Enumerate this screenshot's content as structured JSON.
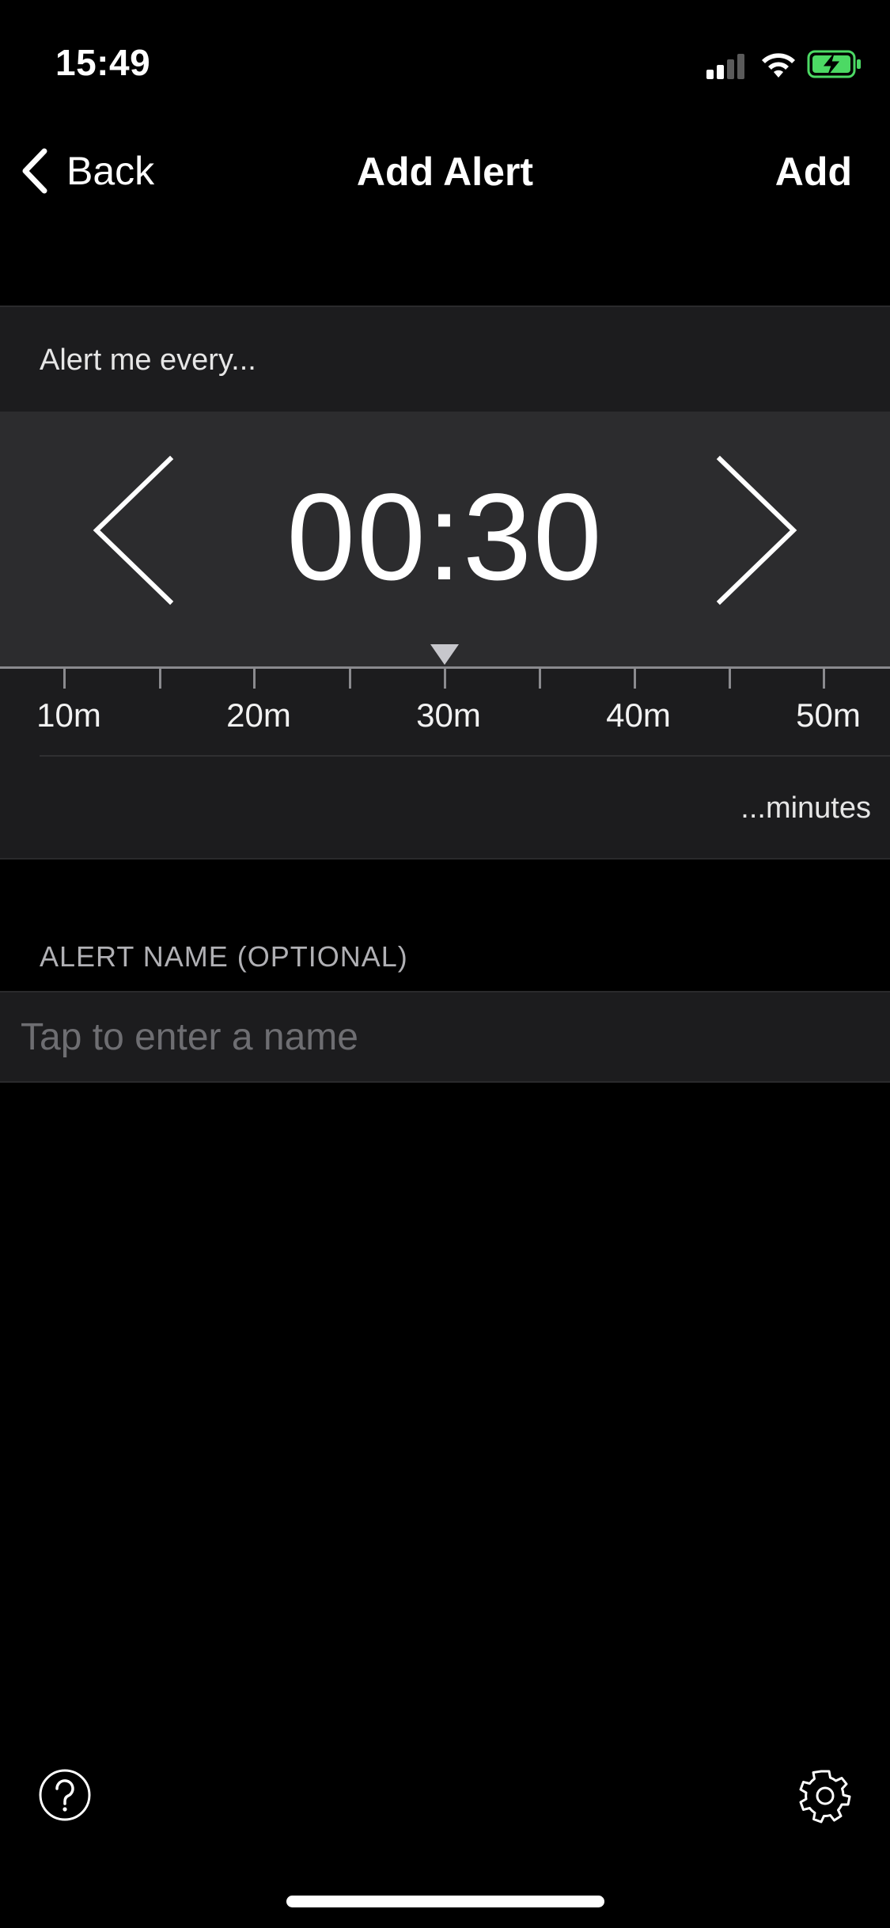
{
  "status_bar": {
    "time": "15:49",
    "battery_color": "#4cd964"
  },
  "nav": {
    "back_label": "Back",
    "title": "Add Alert",
    "add_label": "Add"
  },
  "interval": {
    "heading": "Alert me every...",
    "time_value": "00:30",
    "ruler_labels": [
      "10m",
      "20m",
      "30m",
      "40m",
      "50m"
    ],
    "selected_minutes": 30,
    "unit_label": "...minutes"
  },
  "alert_name": {
    "section_header": "ALERT NAME (OPTIONAL)",
    "placeholder": "Tap to enter a name",
    "value": ""
  },
  "icons": {
    "help": "question-circle-icon",
    "settings": "gear-icon"
  }
}
